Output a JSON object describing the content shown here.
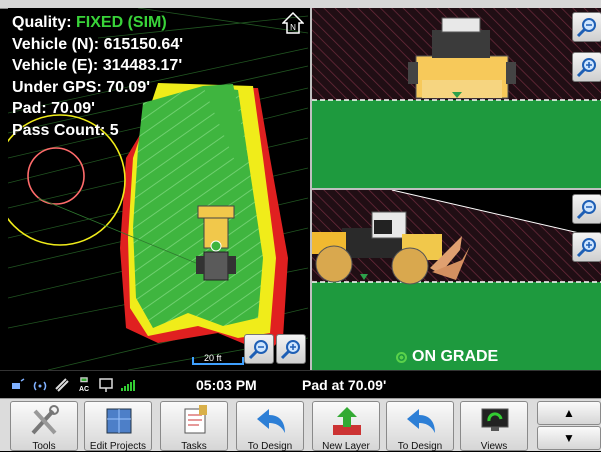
{
  "info": {
    "quality_label": "Quality:",
    "quality_value": "FIXED (SIM)",
    "vehicle_n": "Vehicle (N): 615150.64'",
    "vehicle_e": "Vehicle (E): 314483.17'",
    "under_gps": "Under GPS: 70.09'",
    "pad": "Pad: 70.09'",
    "pass_count": "Pass Count: 5"
  },
  "plan": {
    "scale_label": "20 ft",
    "north_label": "N"
  },
  "views": {
    "on_grade_label": "ON GRADE"
  },
  "status": {
    "time": "05:03 PM",
    "pad_text": "Pad at 70.09'",
    "ac_label": "AC"
  },
  "toolbar": {
    "buttons": [
      {
        "label": "Tools",
        "icon": "tools-icon"
      },
      {
        "label": "Edit Projects",
        "icon": "edit-projects-icon"
      },
      {
        "label": "Tasks",
        "icon": "tasks-icon"
      },
      {
        "label": "To Design",
        "icon": "back-arrow-icon"
      },
      {
        "label": "New Layer",
        "icon": "new-layer-icon"
      },
      {
        "label": "To Design",
        "icon": "back-arrow-icon"
      },
      {
        "label": "Views",
        "icon": "views-icon"
      }
    ],
    "up_label": "▲",
    "down_label": "▼"
  },
  "colors": {
    "fill_green": "#33a033",
    "cut_red": "#e02020",
    "yellow": "#f0ec1a",
    "grade_green": "#1e9a3e",
    "dirt": "#5a2a35"
  }
}
